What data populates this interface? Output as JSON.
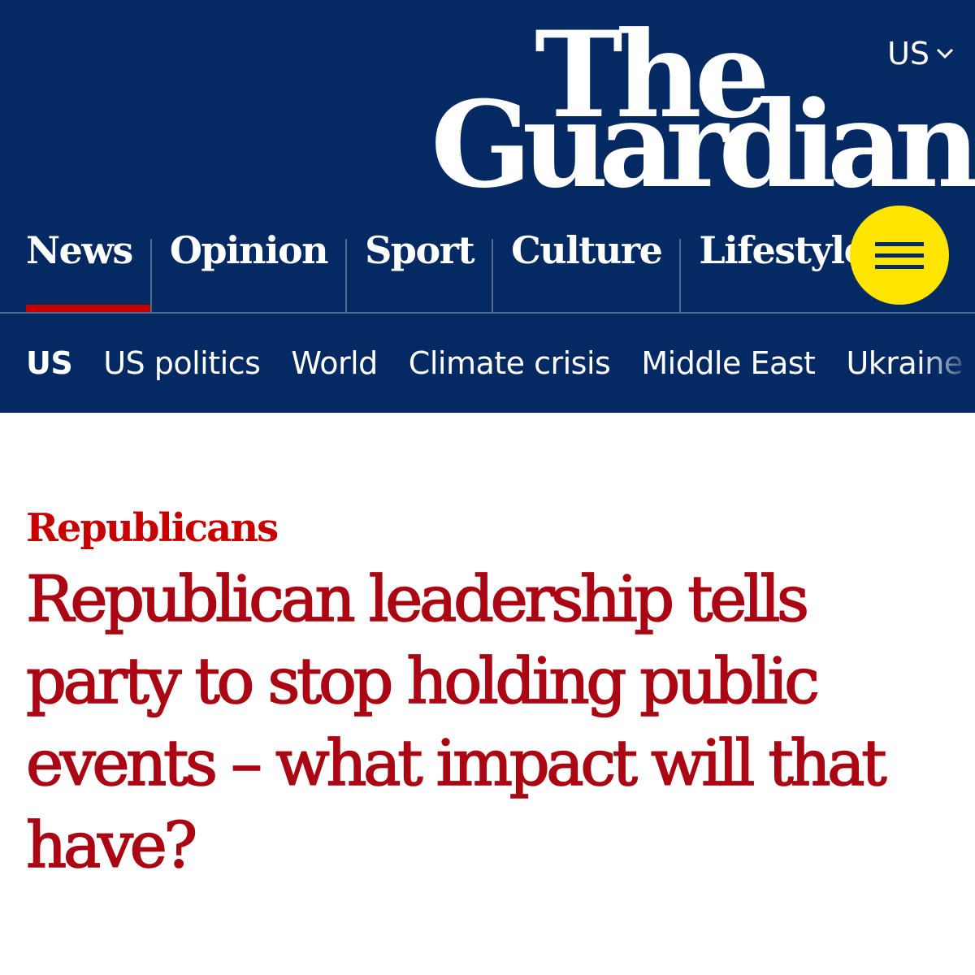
{
  "brand": {
    "logo_line1": "The",
    "logo_line2": "Guardian",
    "edition": "US",
    "colors": {
      "masthead": "#052962",
      "menu_button": "#ffe500",
      "news_accent": "#c70000",
      "headline": "#ab0613"
    }
  },
  "pillars": [
    {
      "label": "News",
      "active": true
    },
    {
      "label": "Opinion",
      "active": false
    },
    {
      "label": "Sport",
      "active": false
    },
    {
      "label": "Culture",
      "active": false
    },
    {
      "label": "Lifestyle",
      "active": false
    }
  ],
  "menu": {
    "icon": "hamburger-menu-icon"
  },
  "subnav": [
    {
      "label": "US",
      "current": true
    },
    {
      "label": "US politics",
      "current": false
    },
    {
      "label": "World",
      "current": false
    },
    {
      "label": "Climate crisis",
      "current": false
    },
    {
      "label": "Middle East",
      "current": false
    },
    {
      "label": "Ukraine",
      "current": false
    }
  ],
  "article": {
    "kicker": "Republicans",
    "headline": "Republican leadership tells party to stop holding public events – what impact will that have?"
  }
}
